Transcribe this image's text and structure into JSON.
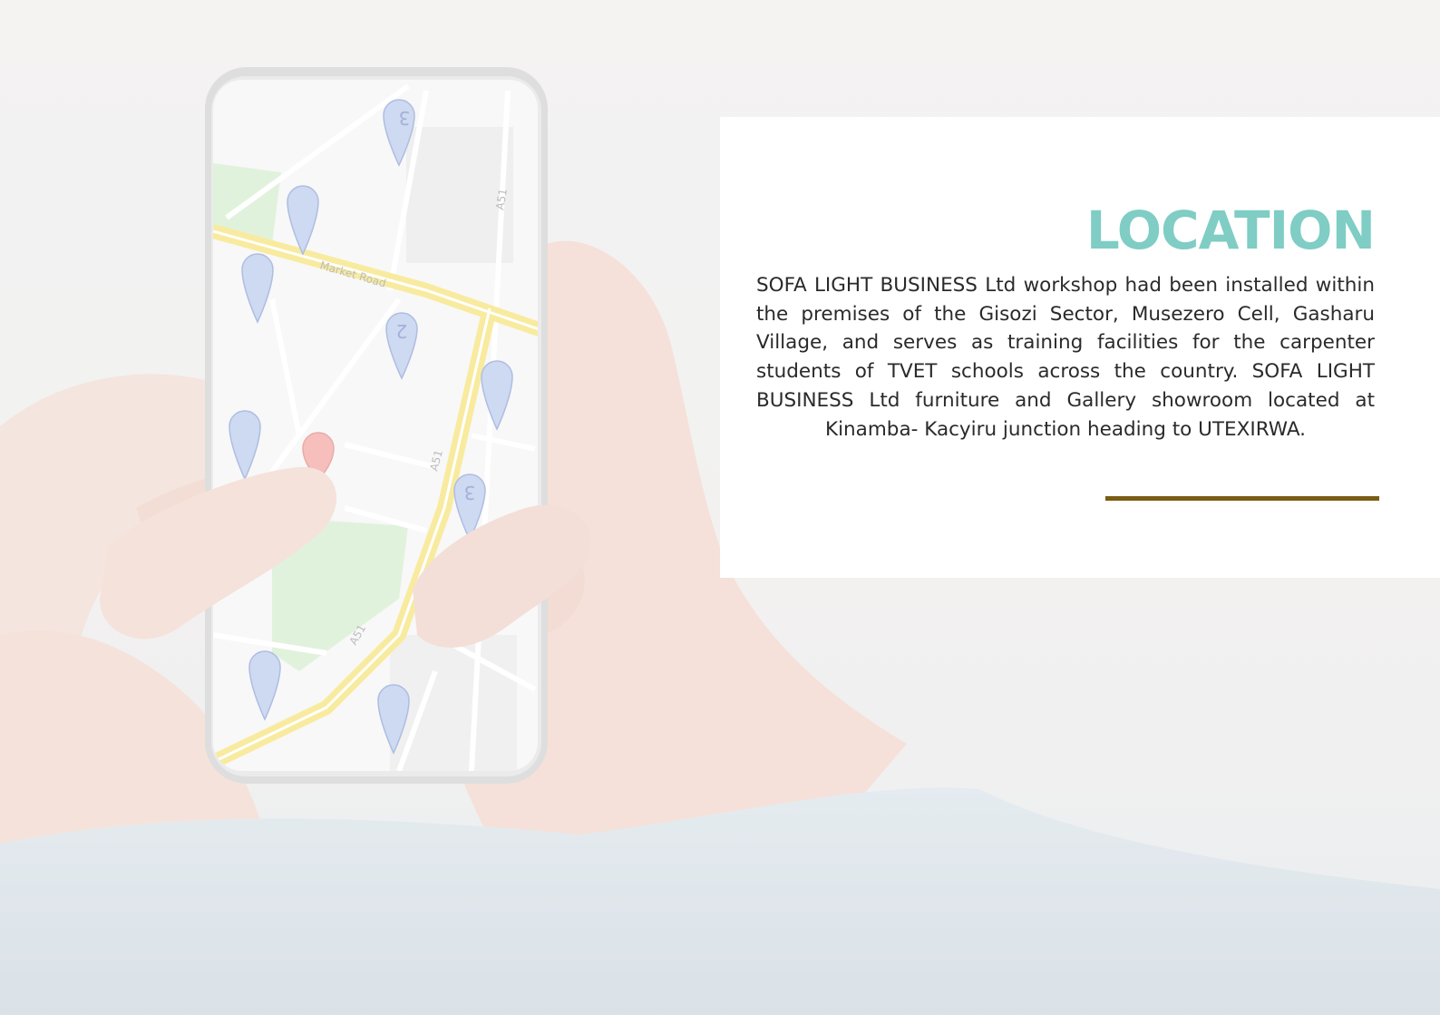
{
  "section": {
    "title": "LOCATION",
    "body": "SOFA LIGHT BUSINESS Ltd workshop had been installed within the premises of the Gisozi Sector, Musezero Cell, Gasharu Village, and serves as train­ing facilities for the carpenter students of TVET schools across the country. SOFA LIGHT BUSINESS Ltd furniture and Gallery showroom located at Kinamba- Kacyiru junction heading to UTEXIRWA."
  },
  "map_labels": {
    "market_road": "Market Road",
    "a51_top": "A51",
    "a51_middle": "A51",
    "a51_bottom": "A51",
    "pin_3_top": "3",
    "pin_2": "2",
    "pin_3_right": "3"
  },
  "colors": {
    "title": "#7fcdc4",
    "accent_rule": "#7a5c14",
    "map_road": "#f5e36b",
    "map_park": "#cfe9c4",
    "pin_blue": "#b9c9ec",
    "pin_red": "#f0a3a0"
  }
}
